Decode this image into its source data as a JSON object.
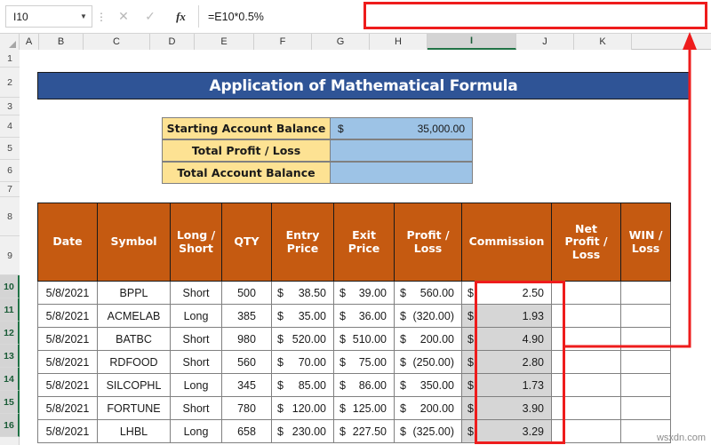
{
  "formula_bar": {
    "name_box_value": "I10",
    "name_box_caret_icon": "chevron-down-icon",
    "grip_icon": "vertical-dots-icon",
    "cancel_icon": "close-icon",
    "confirm_icon": "check-icon",
    "fx_label": "fx",
    "formula_value": "=E10*0.5%",
    "highlight_color": "#ee1c1c"
  },
  "columns": [
    "A",
    "B",
    "C",
    "D",
    "E",
    "F",
    "G",
    "H",
    "I",
    "J",
    "K"
  ],
  "selected_column": "I",
  "rows": [
    "1",
    "2",
    "3",
    "4",
    "5",
    "6",
    "7",
    "8",
    "9",
    "10",
    "11",
    "12",
    "13",
    "14",
    "15",
    "16"
  ],
  "selected_rows": [
    "10",
    "11",
    "12",
    "13",
    "14",
    "15",
    "16"
  ],
  "sheet": {
    "title": "Application of Mathematical Formula",
    "title_bg": "#2F5496",
    "header_bg": "#C55A11",
    "label_bg": "#FDE293",
    "value_bg": "#9DC3E6"
  },
  "summary": [
    {
      "label": "Starting Account Balance",
      "currency": "$",
      "amount": "35,000.00"
    },
    {
      "label": "Total Profit / Loss",
      "currency": "",
      "amount": ""
    },
    {
      "label": "Total Account Balance",
      "currency": "",
      "amount": ""
    }
  ],
  "table": {
    "headers": [
      "Date",
      "Symbol",
      "Long /\nShort",
      "QTY",
      "Entry\nPrice",
      "Exit\nPrice",
      "Profit /\nLoss",
      "Commission",
      "Net\nProfit /\nLoss",
      "WIN /\nLoss"
    ],
    "rows": [
      {
        "row": "10",
        "date": "5/8/2021",
        "symbol": "BPPL",
        "long_short": "Short",
        "qty": "500",
        "entry": "38.50",
        "exit": "39.00",
        "profit_loss": "560.00",
        "commission": "2.50",
        "net_profit_loss": "",
        "win_loss": "",
        "active": true
      },
      {
        "row": "11",
        "date": "5/8/2021",
        "symbol": "ACMELAB",
        "long_short": "Long",
        "qty": "385",
        "entry": "35.00",
        "exit": "36.00",
        "profit_loss": "(320.00)",
        "commission": "1.93",
        "net_profit_loss": "",
        "win_loss": "",
        "active": false
      },
      {
        "row": "12",
        "date": "5/8/2021",
        "symbol": "BATBC",
        "long_short": "Short",
        "qty": "980",
        "entry": "520.00",
        "exit": "510.00",
        "profit_loss": "200.00",
        "commission": "4.90",
        "net_profit_loss": "",
        "win_loss": "",
        "active": false
      },
      {
        "row": "13",
        "date": "5/8/2021",
        "symbol": "RDFOOD",
        "long_short": "Short",
        "qty": "560",
        "entry": "70.00",
        "exit": "75.00",
        "profit_loss": "(250.00)",
        "commission": "2.80",
        "net_profit_loss": "",
        "win_loss": "",
        "active": false
      },
      {
        "row": "14",
        "date": "5/8/2021",
        "symbol": "SILCOPHL",
        "long_short": "Long",
        "qty": "345",
        "entry": "85.00",
        "exit": "86.00",
        "profit_loss": "350.00",
        "commission": "1.73",
        "net_profit_loss": "",
        "win_loss": "",
        "active": false
      },
      {
        "row": "15",
        "date": "5/8/2021",
        "symbol": "FORTUNE",
        "long_short": "Short",
        "qty": "780",
        "entry": "120.00",
        "exit": "125.00",
        "profit_loss": "200.00",
        "commission": "3.90",
        "net_profit_loss": "",
        "win_loss": "",
        "active": false
      },
      {
        "row": "16",
        "date": "5/8/2021",
        "symbol": "LHBL",
        "long_short": "Long",
        "qty": "658",
        "entry": "230.00",
        "exit": "227.50",
        "profit_loss": "(325.00)",
        "commission": "3.29",
        "net_profit_loss": "",
        "win_loss": "",
        "active": false
      }
    ],
    "currency_symbol": "$"
  },
  "annotation": {
    "color": "#ee1c1c",
    "selection_label": "commission-column-highlight",
    "arrow_label": "formula-bar-arrow"
  },
  "watermark": "wsxdn.com"
}
